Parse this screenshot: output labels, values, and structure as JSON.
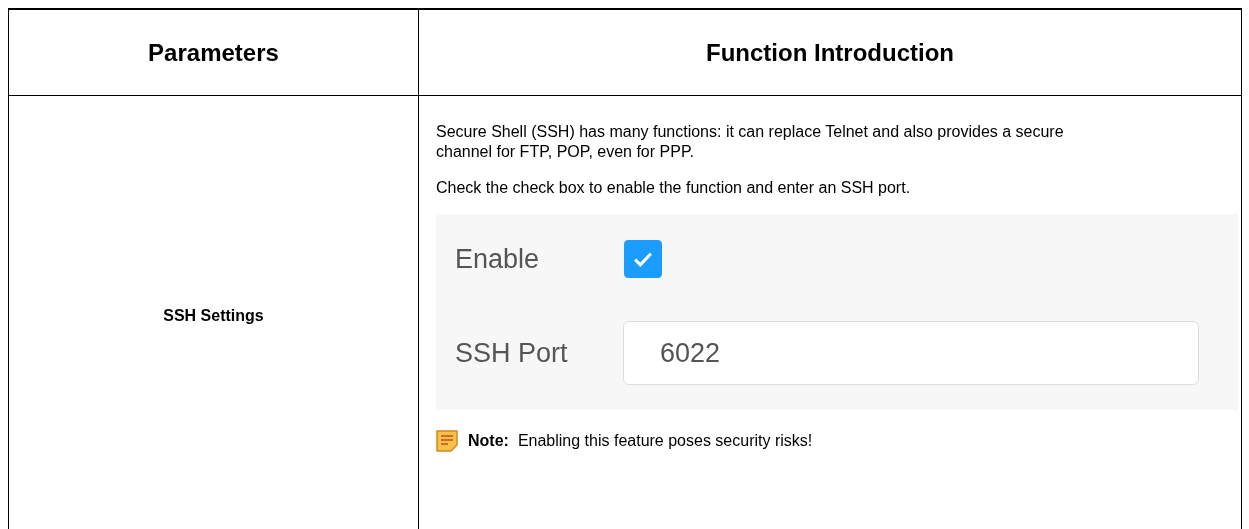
{
  "table": {
    "columns": [
      "Parameters",
      "Function Introduction"
    ],
    "rows": [
      {
        "parameter": "SSH Settings",
        "paragraphs": [
          "Secure Shell (SSH) has many functions: it can replace Telnet and also provides a secure channel for FTP, POP, even for PPP.",
          "Check the check box to enable the function and enter an SSH port."
        ],
        "settings": {
          "enable": {
            "label": "Enable",
            "checked": true
          },
          "port": {
            "label": "SSH Port",
            "value": "6022"
          }
        },
        "note": {
          "label": "Note:",
          "text": "Enabling this feature poses security risks!"
        }
      }
    ]
  }
}
